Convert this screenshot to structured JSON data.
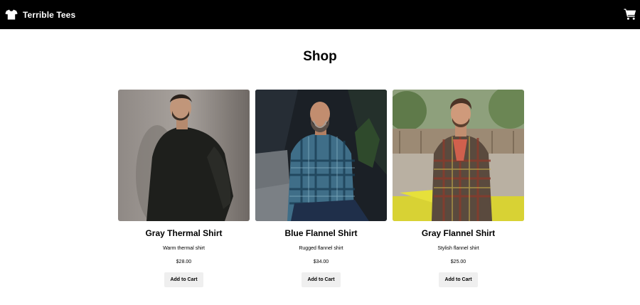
{
  "nav": {
    "brand_name": "Terrible Tees",
    "logo_icon": "tshirt-icon",
    "cart_icon": "shopping-cart-icon"
  },
  "page": {
    "title": "Shop"
  },
  "products": [
    {
      "name": "Gray Thermal Shirt",
      "description": "Warm thermal shirt",
      "price": "$28.00",
      "button_label": "Add to Cart"
    },
    {
      "name": "Blue Flannel Shirt",
      "description": "Rugged flannel shirt",
      "price": "$34.00",
      "button_label": "Add to Cart"
    },
    {
      "name": "Gray Flannel Shirt",
      "description": "Stylish flannel shirt",
      "price": "$25.00",
      "button_label": "Add to Cart"
    }
  ],
  "colors": {
    "navbar_bg": "#000000",
    "button_bg": "#efefef"
  }
}
